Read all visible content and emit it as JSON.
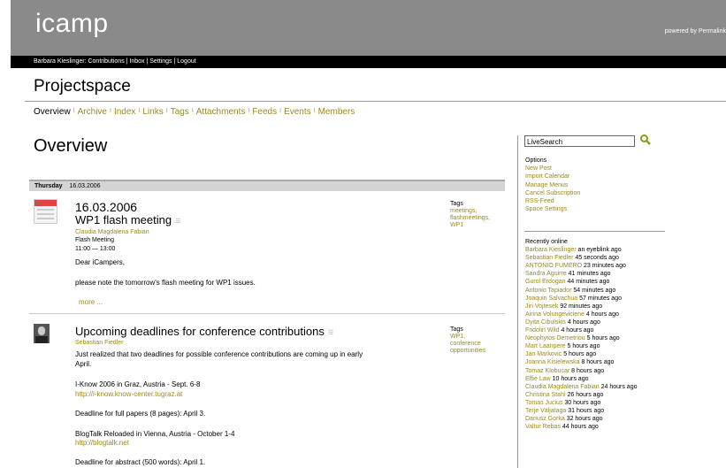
{
  "header": {
    "logo": "icamp",
    "powered_by": "powered by Permalink"
  },
  "userbar": {
    "text": "Barbara Kieslinger: Contributions | Inbox | Settings | Logout"
  },
  "page_title": "Projectspace",
  "tabs": [
    {
      "label": "Overview"
    },
    {
      "label": "Archive"
    },
    {
      "label": "Index"
    },
    {
      "label": "Links"
    },
    {
      "label": "Tags"
    },
    {
      "label": "Attachments"
    },
    {
      "label": "Feeds"
    },
    {
      "label": "Events"
    },
    {
      "label": "Members"
    }
  ],
  "main_heading": "Overview",
  "day_bar": {
    "day": "Thursday",
    "date": "16.03.2006"
  },
  "post1": {
    "date_heading": "16.03.2006",
    "title": "WP1 flash meeting",
    "author": "Claudia Magdalena Fabian",
    "event_name": "Flash Meeting",
    "event_time": "11:00 — 13:00",
    "greeting": "Dear iCampers,",
    "body": "please note the tomorrow's  flash meeting for WP1 issues.",
    "more": "more ...",
    "tags_label": "Tags",
    "tags": [
      "meetings,",
      "flashmeetings,",
      "WP1"
    ]
  },
  "post2": {
    "title": "Upcoming deadlines for conference contributions",
    "author": "Sebastian Fiedler",
    "body_line1": "Just realized that two deadlines for possible conference contributions are coming up in early",
    "body_line2": "April.",
    "conf1": "I-Know 2006 in Graz, Austria - Sept. 6-8",
    "conf1_link": "http://i-know.know-center.tugraz.at",
    "conf1_deadline": "Deadline for full papers (8 pages): April 3.",
    "conf2": "BlogTalk Reloaded in Vienna, Austria - October 1-4",
    "conf2_link": "http://blogtalk.net",
    "conf2_deadline": "Deadline for abstract (500 words): April 1.",
    "tags_label": "Tags",
    "tags": [
      "WP1,",
      "conference",
      "opportunities"
    ]
  },
  "sidebar": {
    "search_placeholder": "LiveSearch",
    "options_label": "Options",
    "options": [
      "New Post",
      "Import Calendar",
      "Manage Menus",
      "Cancel Subscription",
      "RSS-Feed",
      "Space Settings"
    ],
    "online_label": "Recently online",
    "online": [
      {
        "name": "Barbara Kieslinger",
        "time": "an eyeblink ago"
      },
      {
        "name": "Sebastian Fiedler",
        "time": "45 seconds ago"
      },
      {
        "name": "ANTONIO FUMERO",
        "time": "23 minutes ago"
      },
      {
        "name": "Sandra Aguirre",
        "time": "41 minutes ago"
      },
      {
        "name": "Gurol Erdogan",
        "time": "44 minutes ago"
      },
      {
        "name": "Antonio Tapiador",
        "time": "54 minutes ago"
      },
      {
        "name": "Joaquin Salvachua",
        "time": "57 minutes ago"
      },
      {
        "name": "Jiri Vojtesek",
        "time": "92 minutes ago"
      },
      {
        "name": "Airina Volungeviciene",
        "time": "4 hours ago"
      },
      {
        "name": "Dyita Cibulskis",
        "time": "4 hours ago"
      },
      {
        "name": "Fridolin Wild",
        "time": "4 hours ago"
      },
      {
        "name": "Neophytos Demetriou",
        "time": "5 hours ago"
      },
      {
        "name": "Mart Laanpere",
        "time": "5 hours ago"
      },
      {
        "name": "Jan Markovic",
        "time": "5 hours ago"
      },
      {
        "name": "Joanna Kisielewska",
        "time": "8 hours ago"
      },
      {
        "name": "Tomaz Klobucar",
        "time": "8 hours ago"
      },
      {
        "name": "Effie Law",
        "time": "10 hours ago"
      },
      {
        "name": "Claudia Magdalena Fabian",
        "time": "24 hours ago"
      },
      {
        "name": "Christina Stahl",
        "time": "26 hours ago"
      },
      {
        "name": "Tomas Jucius",
        "time": "30 hours ago"
      },
      {
        "name": "Terje Väljataga",
        "time": "31 hours ago"
      },
      {
        "name": "Dariusz Gorka",
        "time": "32 hours ago"
      },
      {
        "name": "Valtur Rebas",
        "time": "44 hours ago"
      }
    ]
  },
  "colors": {
    "link": "#9a8a1e",
    "header_bg": "#8a8a8a",
    "userbar_bg": "#000000"
  }
}
